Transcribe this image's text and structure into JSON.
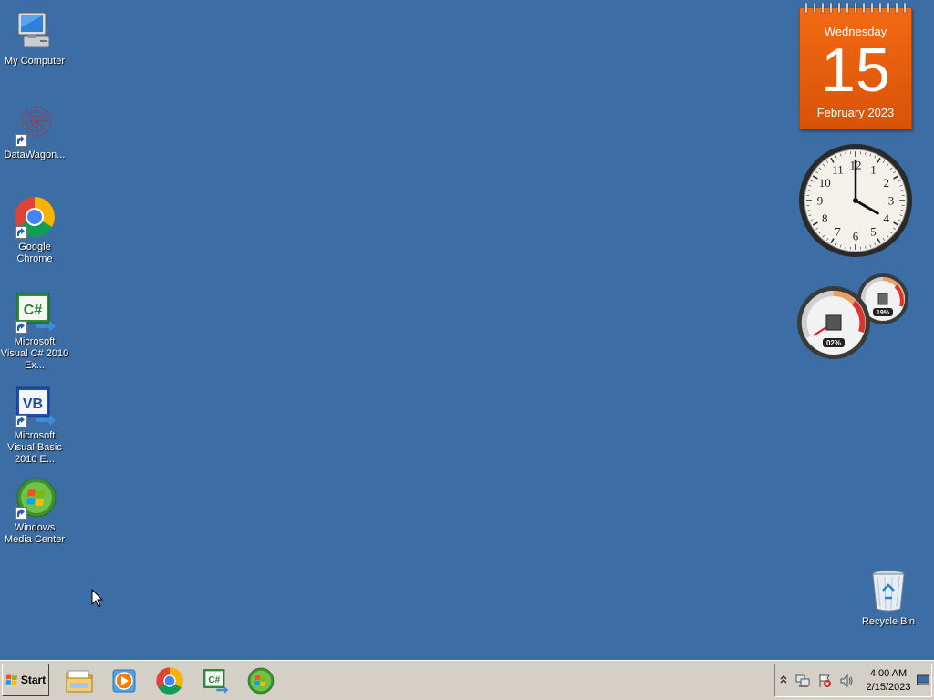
{
  "desktop": {
    "icons": [
      {
        "label": "My Computer"
      },
      {
        "label": "DataWagon..."
      },
      {
        "label": "Google Chrome"
      },
      {
        "label": "Microsoft Visual C# 2010 Ex..."
      },
      {
        "label": "Microsoft Visual Basic 2010 E..."
      },
      {
        "label": "Windows Media Center"
      }
    ],
    "recycle_bin": {
      "label": "Recycle Bin"
    }
  },
  "gadgets": {
    "calendar": {
      "weekday": "Wednesday",
      "day": "15",
      "month_year": "February 2023"
    },
    "clock": {
      "numbers": [
        "12",
        "1",
        "2",
        "3",
        "4",
        "5",
        "6",
        "7",
        "8",
        "9",
        "10",
        "11"
      ],
      "hour": 4,
      "minute": 0
    },
    "cpu_meter": {
      "cpu": "02%",
      "memory": "19%"
    }
  },
  "taskbar": {
    "start_label": "Start",
    "pinned": [
      "file-explorer-icon",
      "media-player-icon",
      "chrome-icon",
      "visual-csharp-icon",
      "windows-media-center-icon"
    ],
    "tray": {
      "time": "4:00 AM",
      "date": "2/15/2023"
    }
  },
  "colors": {
    "desktop": "#3c6ea5",
    "taskbar": "#d4d0c8",
    "calendar": "#e85d0c"
  }
}
